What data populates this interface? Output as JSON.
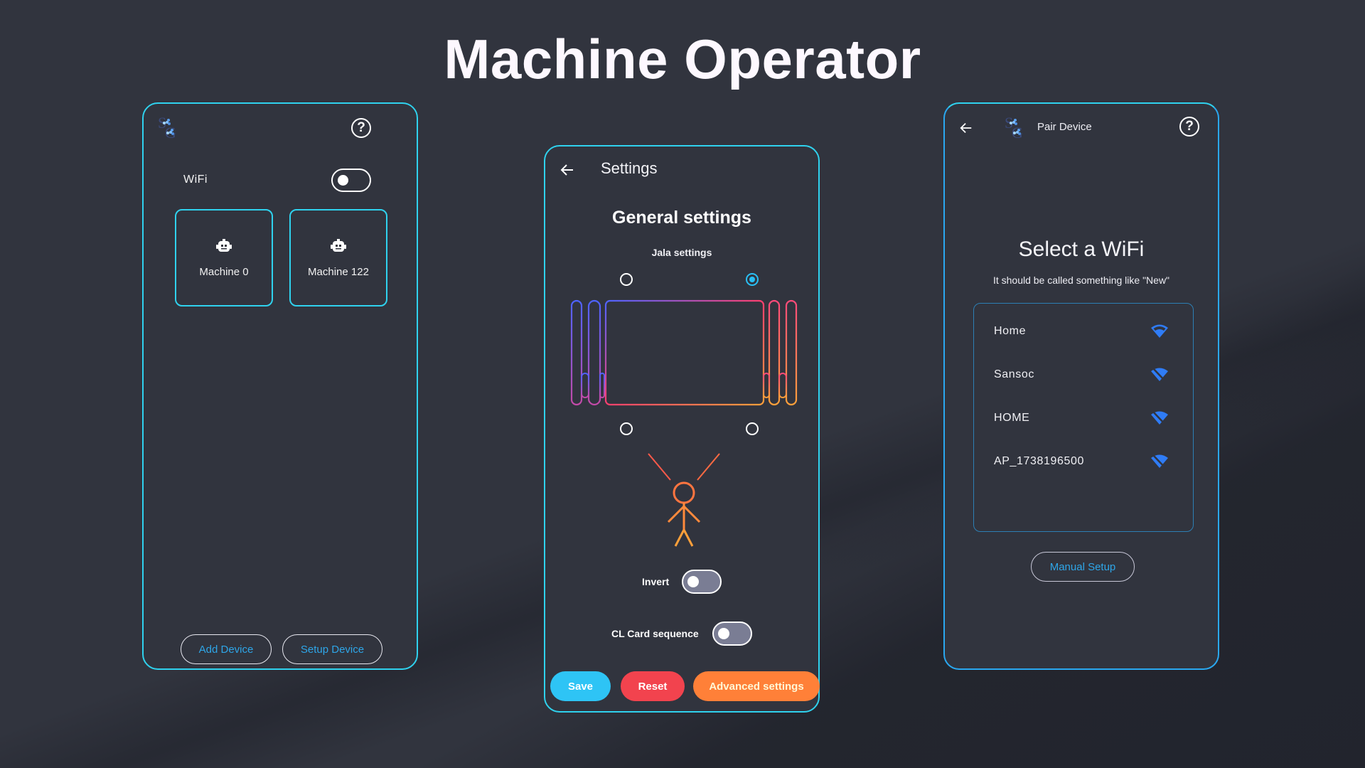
{
  "page": {
    "title": "Machine Operator"
  },
  "colors": {
    "accent": "#2fd2ee",
    "save": "#2ec4f5",
    "reset": "#f2434e",
    "advanced": "#ff8038",
    "link": "#2ea6e8",
    "wifi_icon": "#2f7cf6"
  },
  "home": {
    "logo_icon": "sg-logo-icon",
    "help_icon": "help-circle-icon",
    "wifi_label": "WiFi",
    "wifi_toggle_on": false,
    "machines": [
      {
        "label": "Machine 0",
        "icon": "robot-icon"
      },
      {
        "label": "Machine 122",
        "icon": "robot-icon"
      }
    ],
    "add_device_label": "Add Device",
    "setup_device_label": "Setup Device"
  },
  "settings": {
    "back_icon": "arrow-left-icon",
    "header_title": "Settings",
    "section_title": "General settings",
    "jala_label": "Jala settings",
    "radio_selected": "top-right",
    "invert_label": "Invert",
    "invert_on": false,
    "cl_card_label": "CL Card sequence",
    "cl_card_on": false,
    "save_label": "Save",
    "reset_label": "Reset",
    "advanced_label": "Advanced settings"
  },
  "pair": {
    "back_icon": "arrow-left-icon",
    "logo_icon": "sg-logo-icon",
    "header_title": "Pair Device",
    "help_icon": "help-circle-icon",
    "heading": "Select a WiFi",
    "subheading": "It should be called something like \"New\"",
    "networks": [
      {
        "name": "Home",
        "signal": "wifi-icon"
      },
      {
        "name": "Sansoc",
        "signal": "wifi-off-icon"
      },
      {
        "name": "HOME",
        "signal": "wifi-off-icon"
      },
      {
        "name": "AP_1738196500",
        "signal": "wifi-off-icon"
      }
    ],
    "manual_setup_label": "Manual Setup"
  }
}
